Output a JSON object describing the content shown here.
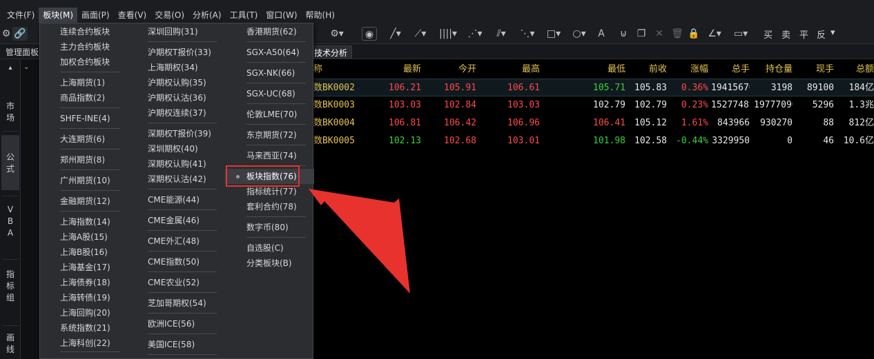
{
  "menubar": {
    "items": [
      "文件(F)",
      "板块(M)",
      "画面(P)",
      "查看(V)",
      "交易(O)",
      "分析(A)",
      "工具(T)",
      "窗口(W)",
      "帮助(H)"
    ]
  },
  "toolbar": {
    "trade_buttons": [
      "买",
      "卖",
      "平",
      "反"
    ]
  },
  "tabs": {
    "left": "管理面板",
    "right": "技术分析"
  },
  "sidebar": {
    "items": [
      "市\n场",
      "公\n式",
      "V\nB\nA",
      "指\n标\n组",
      "画\n线"
    ]
  },
  "dropdown": {
    "col1": [
      "连续合约板块",
      "主力合约板块",
      "加权合约板块",
      "上海期货(1)",
      "商品指数(2)",
      "SHFE-INE(4)",
      "大连期货(6)",
      "郑州期货(8)",
      "广州期货(10)",
      "金融期货(12)",
      "上海指数(14)",
      "上海A股(15)",
      "上海B股(16)",
      "上海基金(17)",
      "上海债券(18)",
      "上海转债(19)",
      "上海回购(20)",
      "系统指数(21)",
      "上海科创(22)"
    ],
    "col2": [
      "深圳回购(31)",
      "沪期权T报价(33)",
      "上海期权(34)",
      "沪期权认购(35)",
      "沪期权认沽(36)",
      "沪期权连续(37)",
      "深期权T报价(39)",
      "深圳期权(40)",
      "深期权认购(41)",
      "深期权认沽(42)",
      "CME能源(44)",
      "CME金属(46)",
      "CME外汇(48)",
      "CME指数(50)",
      "CME农业(52)",
      "芝加哥期权(54)",
      "欧洲ICE(56)",
      "美国ICE(58)"
    ],
    "col3": [
      "香港期货(62)",
      "SGX-A50(64)",
      "SGX-NK(66)",
      "SGX-UC(68)",
      "伦敦LME(70)",
      "东京期货(72)",
      "马来西亚(74)",
      "板块指数(76)",
      "指标统计(77)",
      "套利合约(78)",
      "数字币(80)",
      "自选股(C)",
      "分类板块(B)"
    ]
  },
  "table": {
    "headers": [
      "称",
      "最新",
      "今开",
      "最高",
      "最低",
      "前收",
      "涨幅",
      "总手",
      "持仓量",
      "现手",
      "总额"
    ],
    "rows": [
      [
        "数BK0002",
        "106.21",
        "105.91",
        "106.61",
        "105.71",
        "105.83",
        "0.36%",
        "1941567€",
        "3198",
        "89100",
        "184亿"
      ],
      [
        "数BK0003",
        "103.03",
        "102.84",
        "103.03",
        "102.79",
        "102.79",
        "0.23%",
        "1527748‡",
        "1977709€",
        "5296",
        "1.3兆"
      ],
      [
        "数BK0004",
        "106.81",
        "106.42",
        "106.96",
        "106.41",
        "105.12",
        "1.61%",
        "843966",
        "930270",
        "88",
        "812亿"
      ],
      [
        "数BK0005",
        "102.13",
        "102.68",
        "103.01",
        "101.98",
        "102.58",
        "-0.44%",
        "3329950",
        "0",
        "46",
        "10.6亿"
      ]
    ],
    "colors": [
      [
        "yellow",
        "red",
        "red",
        "red",
        "green",
        "white",
        "red",
        "white",
        "white",
        "white",
        "white"
      ],
      [
        "yellow",
        "red",
        "red",
        "red",
        "white",
        "white",
        "red",
        "white",
        "white",
        "white",
        "white"
      ],
      [
        "yellow",
        "red",
        "red",
        "red",
        "red",
        "white",
        "red",
        "white",
        "white",
        "white",
        "white"
      ],
      [
        "yellow",
        "green",
        "red",
        "red",
        "green",
        "white",
        "green",
        "white",
        "white",
        "white",
        "white"
      ]
    ]
  },
  "colors": {
    "up": "#ff4a4a",
    "down": "#3bd13b",
    "header": "#e2c24e",
    "annotation": "#e8322e"
  }
}
